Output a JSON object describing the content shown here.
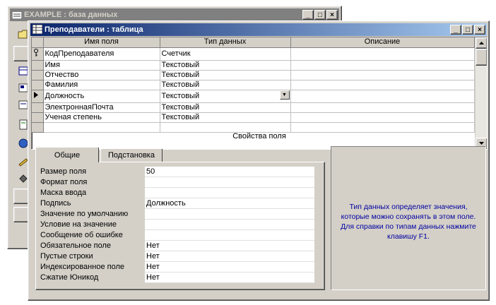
{
  "back_window": {
    "title": "EXAMPLE : база данных",
    "buttons": {
      "minimize": "_",
      "maximize": "□",
      "close": "×"
    },
    "icons": [
      "database-icon",
      "open-folder-icon",
      "table-icon",
      "query-icon",
      "form-icon",
      "report-icon",
      "page-icon",
      "macro-icon",
      "module-icon"
    ]
  },
  "front_window": {
    "title": "Преподаватели : таблица",
    "buttons": {
      "minimize": "_",
      "maximize": "□",
      "close": "×"
    }
  },
  "grid": {
    "columns": [
      "Имя поля",
      "Тип данных",
      "Описание"
    ],
    "rows": [
      {
        "name": "КодПреподавателя",
        "type": "Счетчик",
        "description": "",
        "key": true
      },
      {
        "name": "Имя",
        "type": "Текстовый",
        "description": ""
      },
      {
        "name": "Отчество",
        "type": "Текстовый",
        "description": ""
      },
      {
        "name": "Фамилия",
        "type": "Текстовый",
        "description": ""
      },
      {
        "name": "Должность",
        "type": "Текстовый",
        "description": "",
        "current": true
      },
      {
        "name": "ЭлектроннаяПочта",
        "type": "Текстовый",
        "description": ""
      },
      {
        "name": "Ученая степень",
        "type": "Текстовый",
        "description": ""
      },
      {
        "name": "",
        "type": "",
        "description": ""
      }
    ]
  },
  "properties": {
    "section_label": "Свойства поля",
    "tabs": [
      "Общие",
      "Подстановка"
    ],
    "items": [
      {
        "label": "Размер поля",
        "value": "50"
      },
      {
        "label": "Формат поля",
        "value": ""
      },
      {
        "label": "Маска ввода",
        "value": ""
      },
      {
        "label": "Подпись",
        "value": "Должность"
      },
      {
        "label": "Значение по умолчанию",
        "value": ""
      },
      {
        "label": "Условие на значение",
        "value": ""
      },
      {
        "label": "Сообщение об ошибке",
        "value": ""
      },
      {
        "label": "Обязательное поле",
        "value": "Нет"
      },
      {
        "label": "Пустые строки",
        "value": "Нет"
      },
      {
        "label": "Индексированное поле",
        "value": "Нет"
      },
      {
        "label": "Сжатие Юникод",
        "value": "Нет"
      }
    ],
    "help_text": "Тип данных определяет значения, которые можно сохранять в этом поле.  Для справки по типам данных нажмите клавишу F1."
  },
  "colors": {
    "active_title_start": "#0a246a",
    "active_title_end": "#a6caf0",
    "inactive_title": "#808080",
    "face": "#d4d0c8",
    "help_text": "#0000a0"
  }
}
